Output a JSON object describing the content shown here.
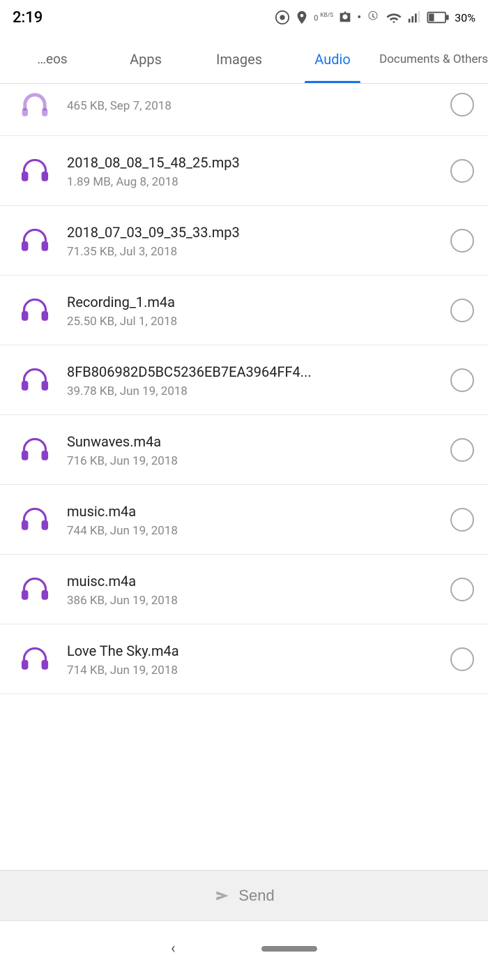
{
  "statusBar": {
    "time": "2:19",
    "batteryPercent": "30%"
  },
  "tabs": [
    {
      "id": "videos",
      "label": "…eos",
      "active": false
    },
    {
      "id": "apps",
      "label": "Apps",
      "active": false
    },
    {
      "id": "images",
      "label": "Images",
      "active": false
    },
    {
      "id": "audio",
      "label": "Audio",
      "active": true
    },
    {
      "id": "documents",
      "label": "Documents & Others",
      "active": false
    }
  ],
  "partialItem": {
    "meta": "465 KB, Sep 7, 2018"
  },
  "files": [
    {
      "id": "file-1",
      "name": "2018_08_08_15_48_25.mp3",
      "meta": "1.89 MB, Aug 8, 2018"
    },
    {
      "id": "file-2",
      "name": "2018_07_03_09_35_33.mp3",
      "meta": "71.35 KB, Jul 3, 2018"
    },
    {
      "id": "file-3",
      "name": "Recording_1.m4a",
      "meta": "25.50 KB, Jul 1, 2018"
    },
    {
      "id": "file-4",
      "name": "8FB806982D5BC5236EB7EA3964FF4...",
      "meta": "39.78 KB, Jun 19, 2018"
    },
    {
      "id": "file-5",
      "name": "Sunwaves.m4a",
      "meta": "716 KB, Jun 19, 2018"
    },
    {
      "id": "file-6",
      "name": "music.m4a",
      "meta": "744 KB, Jun 19, 2018"
    },
    {
      "id": "file-7",
      "name": "muisc.m4a",
      "meta": "386 KB, Jun 19, 2018"
    },
    {
      "id": "file-8",
      "name": "Love The Sky.m4a",
      "meta": "714 KB, Jun 19, 2018"
    }
  ],
  "sendButton": {
    "label": "Send"
  },
  "iconColor": "#8b3fc8"
}
